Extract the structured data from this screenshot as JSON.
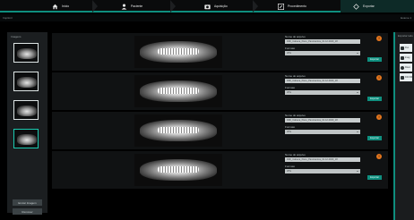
{
  "nav": {
    "items": [
      {
        "label": "Início",
        "icon": "home-icon"
      },
      {
        "label": "Paciente",
        "icon": "user-icon"
      },
      {
        "label": "Aquisição",
        "icon": "camera-icon"
      },
      {
        "label": "Procedimento",
        "icon": "edit-icon"
      },
      {
        "label": "Exportar",
        "icon": "export-icon"
      }
    ],
    "accent": "#0f8f7f"
  },
  "subbar": {
    "left": "Imprimir",
    "right": "Exame 1"
  },
  "left_panel": {
    "title": "Imagens",
    "buttons": {
      "save": "Enviar Imagem",
      "remove": "Remover"
    }
  },
  "rows": [
    {
      "field_label": "Nome do arquivo",
      "field_value": "DMI_Cabeca_Pano_Panoramica_01.12.2020_18",
      "format_label": "Formato",
      "format_value": "JPG",
      "button": "Exportar"
    },
    {
      "field_label": "Nome do arquivo",
      "field_value": "DMI_Cabeca_Pano_Panoramica_01.12.2020_18",
      "format_label": "Formato",
      "format_value": "JPG",
      "button": "Exportar"
    },
    {
      "field_label": "Nome do arquivo",
      "field_value": "DMI_Cabeca_Pano_Panoramica_01.12.2020_18",
      "format_label": "Formato",
      "format_value": "JPG",
      "button": "Exportar"
    },
    {
      "field_label": "Nome do arquivo",
      "field_value": "DMI_Cabeca_Pano_Panoramica_01.12.2020_18",
      "format_label": "Formato",
      "format_value": "JPG",
      "button": "Exportar"
    }
  ],
  "right_toolbar": {
    "title": "Exportar tudo",
    "tools": [
      {
        "label": "Pen",
        "icon": "pen-icon"
      },
      {
        "label": "Imag",
        "icon": "image-icon"
      },
      {
        "label": "Disco",
        "icon": "disc-icon"
      },
      {
        "label": "DICOM",
        "icon": "file-icon"
      }
    ]
  }
}
